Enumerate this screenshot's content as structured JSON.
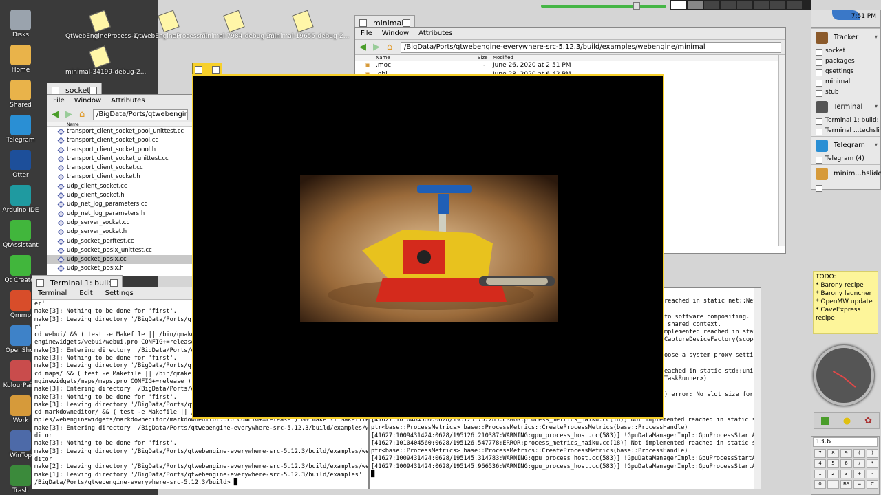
{
  "desktop_icons": [
    {
      "label": "Disks",
      "color": "#9aa3ad"
    },
    {
      "label": "Home",
      "color": "#e9b34a"
    },
    {
      "label": "Shared",
      "color": "#e9b34a"
    },
    {
      "label": "Telegram",
      "color": "#2a8fd4"
    },
    {
      "label": "Otter",
      "color": "#1d4f9a"
    },
    {
      "label": "Arduino IDE",
      "color": "#1f9aa0"
    },
    {
      "label": "QtAssistant",
      "color": "#41b63c"
    },
    {
      "label": "Qt Creator",
      "color": "#41b63c"
    },
    {
      "label": "Qmmp",
      "color": "#d84d2a"
    },
    {
      "label": "OpenShot",
      "color": "#3e82c8"
    },
    {
      "label": "KolourPaint",
      "color": "#c94c4c"
    },
    {
      "label": "Work",
      "color": "#d69a3a"
    },
    {
      "label": "WinTop",
      "color": "#4d6aa8"
    },
    {
      "label": "Trash",
      "color": "#3b8a3b"
    }
  ],
  "file_icons": [
    {
      "label": "QtWebEngineProcess-2..."
    },
    {
      "label": "QtWebEngineProcess-7..."
    },
    {
      "label": "minimal-7984-debug-28..."
    },
    {
      "label": "minimal-19655-debug-2..."
    },
    {
      "label": "minimal-34199-debug-2..."
    }
  ],
  "socket_window": {
    "title": "socket",
    "menu": [
      "File",
      "Window",
      "Attributes"
    ],
    "path": "/BigData/Ports/qtwebengine-everywhere-src-5.12.3/build/src/net/socket",
    "column_name": "Name",
    "files": [
      "transport_client_socket_pool_unittest.cc",
      "transport_client_socket_pool.cc",
      "transport_client_socket_pool.h",
      "transport_client_socket_unittest.cc",
      "transport_client_socket.cc",
      "transport_client_socket.h",
      "udp_client_socket.cc",
      "udp_client_socket.h",
      "udp_net_log_parameters.cc",
      "udp_net_log_parameters.h",
      "udp_server_socket.cc",
      "udp_server_socket.h",
      "udp_socket_perftest.cc",
      "udp_socket_posix_unittest.cc",
      "udp_socket_posix.cc",
      "udp_socket_posix.h",
      "udp_socket_unittest.cc"
    ],
    "selected_index": 14
  },
  "minimal_window": {
    "title": "minimal",
    "menu": [
      "File",
      "Window",
      "Attributes"
    ],
    "path": "/BigData/Ports/qtwebengine-everywhere-src-5.12.3/build/examples/webengine/minimal",
    "columns": {
      "name": "Name",
      "size": "Size",
      "modified": "Modified"
    },
    "files": [
      {
        "name": ".moc",
        "size": "-",
        "modified": "June 26, 2020 at 2:51 PM"
      },
      {
        "name": ".obj",
        "size": "-",
        "modified": "June 28, 2020 at 6:42 PM"
      }
    ]
  },
  "terminal_left": {
    "title": "Terminal 1: build: ~",
    "menu": [
      "Terminal",
      "Edit",
      "Settings"
    ],
    "lines": [
      "er'",
      "make[3]: Nothing to be done for 'first'.",
      "make[3]: Leaving directory '/BigData/Ports/qtwebengine-everywhere-src-5.12.3/build/examples/webenginewidgets/webui'",
      "r'",
      "cd webui/ && ( test -e Makefile || /bin/qmake -o Makefile /BigData/Ports/qtwebengine-everywhere-src-5.12.3/examples/web",
      "enginewidgets/webui/webui.pro CONFIG+=release ) && make -f Makefile",
      "make[3]: Entering directory '/BigData/Ports/qtwebengine-everywhere-src-5.12.3/build/examples/webenginewidgets/webui'",
      "make[3]: Nothing to be done for 'first'.",
      "make[3]: Leaving directory '/BigData/Ports/qtwebengine-everywhere-src-5.12.3/build/examples/webenginewidgets/webui'",
      "cd maps/ && ( test -e Makefile || /bin/qmake -o Makefile /BigData/Ports/qtwebengine-everywhere-src-5.12.3/examples/webe",
      "nginewidgets/maps/maps.pro CONFIG+=release ) && make -f Makefile",
      "make[3]: Entering directory '/BigData/Ports/qtwebengine-everywhere-src-5.12.3/build/examples/webenginewidgets/maps'",
      "make[3]: Nothing to be done for 'first'.",
      "make[3]: Leaving directory '/BigData/Ports/qtwebengine-everywhere-src-5.12.3/build/examples/webenginewidgets/maps'",
      "cd markdowneditor/ && ( test -e Makefile || /bin/qmake -o Makefile /BigData/Ports/qtwebengine-everywhere-src-5.12.3/exa",
      "mples/webenginewidgets/markdowneditor/markdowneditor.pro CONFIG+=release ) && make -f Makefile",
      "make[3]: Entering directory '/BigData/Ports/qtwebengine-everywhere-src-5.12.3/build/examples/webenginewidgets/markdowne",
      "ditor'",
      "make[3]: Nothing to be done for 'first'.",
      "make[3]: Leaving directory '/BigData/Ports/qtwebengine-everywhere-src-5.12.3/build/examples/webenginewidgets/markdowne",
      "ditor'",
      "make[2]: Leaving directory '/BigData/Ports/qtwebengine-everywhere-src-5.12.3/build/examples/webenginewidgets'",
      "make[1]: Leaving directory '/BigData/Ports/qtwebengine-everywhere-src-5.12.3/build/examples'"
    ],
    "prompt": "/BigData/Ports/qtwebengine-everywhere-src-5.12.3/build>"
  },
  "terminal_right": {
    "lines_top": [
      "reached in static net::Netw",
      "",
      "to software compositing.",
      " shared context.",
      "mplemented reached in static std::",
      "CaptureDeviceFactory(scoped",
      "",
      "oose a system proxy setting",
      "",
      "eached in static std::uniqu",
      "TaskRunner>)",
      "",
      ") error: No slot size for a"
    ],
    "lines_bottom": [
      "[41627:1010404560:0628/195125.707285:ERROR:process_metrics_haiku.cc(18)] Not implemented reached in static std::unique_",
      "ptr<base::ProcessMetrics> base::ProcessMetrics::CreateProcessMetrics(base::ProcessHandle)",
      "[41627:1009431424:0628/195126.210387:WARNING:gpu_process_host.cc(583)] !GpuDataManagerImpl::GpuProcessStartAllowed()",
      "[41627:1010404560:0628/195126.547778:ERROR:process_metrics_haiku.cc(18)] Not implemented reached in static std::unique_",
      "ptr<base::ProcessMetrics> base::ProcessMetrics::CreateProcessMetrics(base::ProcessHandle)",
      "[41627:1009431424:0628/195145.314783:WARNING:gpu_process_host.cc(583)] !GpuDataManagerImpl::GpuProcessStartAllowed()",
      "[41627:1009431424:0628/195145.966536:WARNING:gpu_process_host.cc(583)] !GpuDataManagerImpl::GpuProcessStartAllowed()"
    ]
  },
  "deskbar": {
    "time": "7:51 PM",
    "apps": [
      {
        "name": "Tracker",
        "color": "#8b5a2b",
        "items": [
          "socket",
          "packages",
          "qsettings",
          "minimal",
          "stub"
        ]
      },
      {
        "name": "Terminal",
        "color": "#555555",
        "items": [
          "Terminal 1: build: ~",
          "Terminal ...techslides"
        ]
      },
      {
        "name": "Telegram",
        "color": "#2a8fd4",
        "items": [
          "Telegram (4)"
        ]
      },
      {
        "name": "minim...hslides",
        "color": "#d69a3a",
        "items": [
          ""
        ]
      }
    ]
  },
  "sticky_note": {
    "title": "TODO:",
    "items": [
      "* Barony recipe",
      "* Barony launcher",
      "* OpenMW update",
      "* CaveExpress recipe"
    ]
  },
  "calculator": {
    "display": "13.6",
    "keys": [
      "7",
      "8",
      "9",
      "(",
      ")",
      "4",
      "5",
      "6",
      "/",
      "*",
      "1",
      "2",
      "3",
      "+",
      "-",
      "0",
      ".",
      "BS",
      "=",
      "C"
    ]
  },
  "colors": {
    "tab_active": "#f7d02b",
    "desktop": "#3d3d3d",
    "sticky": "#fdf59a",
    "volume_bar": "#46b646"
  }
}
